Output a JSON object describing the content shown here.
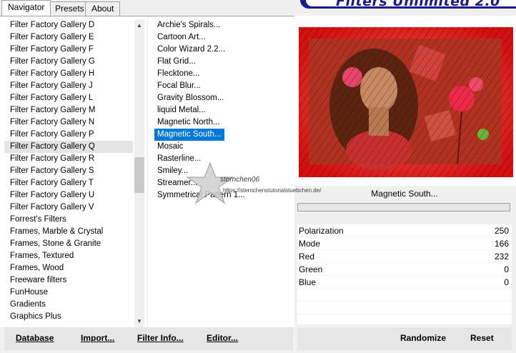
{
  "tabs": [
    "Navigator",
    "Presets",
    "About"
  ],
  "banner_title": "Filters Unlimited 2.0",
  "categories": [
    "Filter Factory Gallery D",
    "Filter Factory Gallery E",
    "Filter Factory Gallery F",
    "Filter Factory Gallery G",
    "Filter Factory Gallery H",
    "Filter Factory Gallery J",
    "Filter Factory Gallery L",
    "Filter Factory Gallery M",
    "Filter Factory Gallery N",
    "Filter Factory Gallery P",
    "Filter Factory Gallery Q",
    "Filter Factory Gallery R",
    "Filter Factory Gallery S",
    "Filter Factory Gallery T",
    "Filter Factory Gallery U",
    "Filter Factory Gallery V",
    "Forrest's Filters",
    "Frames, Marble & Crystal",
    "Frames, Stone & Granite",
    "Frames, Textured",
    "Frames, Wood",
    "Freeware filters",
    "FunHouse",
    "Gradients",
    "Graphics Plus"
  ],
  "selected_category": "Filter Factory Gallery Q",
  "filters": [
    "Archie's Spirals...",
    "Cartoon Art...",
    "Color Wizard 2.2...",
    "Flat Grid...",
    "Flecktone...",
    "Focal Blur...",
    "Gravity Blossom...",
    "liquid Metal...",
    "Magnetic North...",
    "Magnetic South...",
    "Mosaic",
    "Rasterline...",
    "Smiley...",
    "Streamer...",
    "Symmetrical Pattern 1..."
  ],
  "selected_filter": "Magnetic South...",
  "watermark": {
    "text": "sternchen06",
    "url": "https://sternchenstutorialstuebchen.de/"
  },
  "preview_label": "Magnetic South...",
  "params": [
    {
      "name": "Polarization",
      "value": "250"
    },
    {
      "name": "Mode",
      "value": "166"
    },
    {
      "name": "Red",
      "value": "232"
    },
    {
      "name": "Green",
      "value": "0"
    },
    {
      "name": "Blue",
      "value": "0"
    }
  ],
  "buttons": {
    "database": "Database",
    "import": "Import...",
    "filter_info": "Filter Info...",
    "editor": "Editor...",
    "randomize": "Randomize",
    "reset": "Reset"
  },
  "colors": {
    "selection": "#0078d7",
    "banner": "#1a1a8c",
    "preview_bg": "#e01818"
  }
}
